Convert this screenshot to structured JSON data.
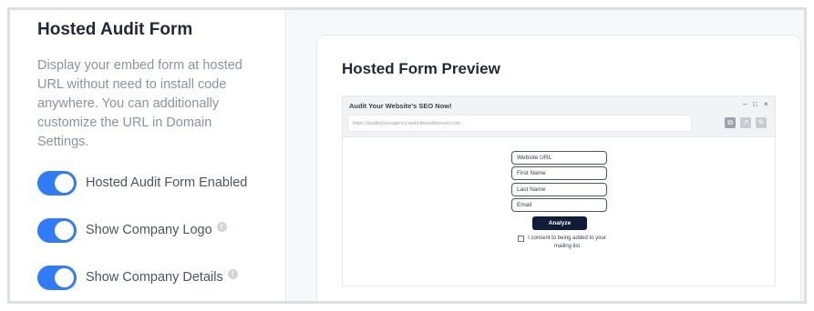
{
  "settings": {
    "title": "Hosted Audit Form",
    "description": "Display your embed form at hosted URL without need to install code anywhere. You can additionally customize the URL in Domain Settings.",
    "toggles": [
      {
        "label": "Hosted Audit Form Enabled",
        "enabled": true,
        "has_info": false
      },
      {
        "label": "Show Company Logo",
        "enabled": true,
        "has_info": true
      },
      {
        "label": "Show Company Details",
        "enabled": true,
        "has_info": true
      }
    ],
    "accent_color": "#2f7cf6"
  },
  "preview_card": {
    "title": "Hosted Form Preview",
    "window": {
      "title": "Audit Your Website's SEO Now!",
      "url": "https://auditsyouragency.websiteauditserver.com",
      "controls": {
        "minimize": "–",
        "maximize": "□",
        "close": "×"
      }
    },
    "form": {
      "fields": [
        "Website URL",
        "First Name",
        "Last Name",
        "Email"
      ],
      "button_label": "Analyze",
      "consent_text": "I consent to being added to your mailing list",
      "consent_checked": false,
      "button_color": "#0f1d3a"
    }
  }
}
